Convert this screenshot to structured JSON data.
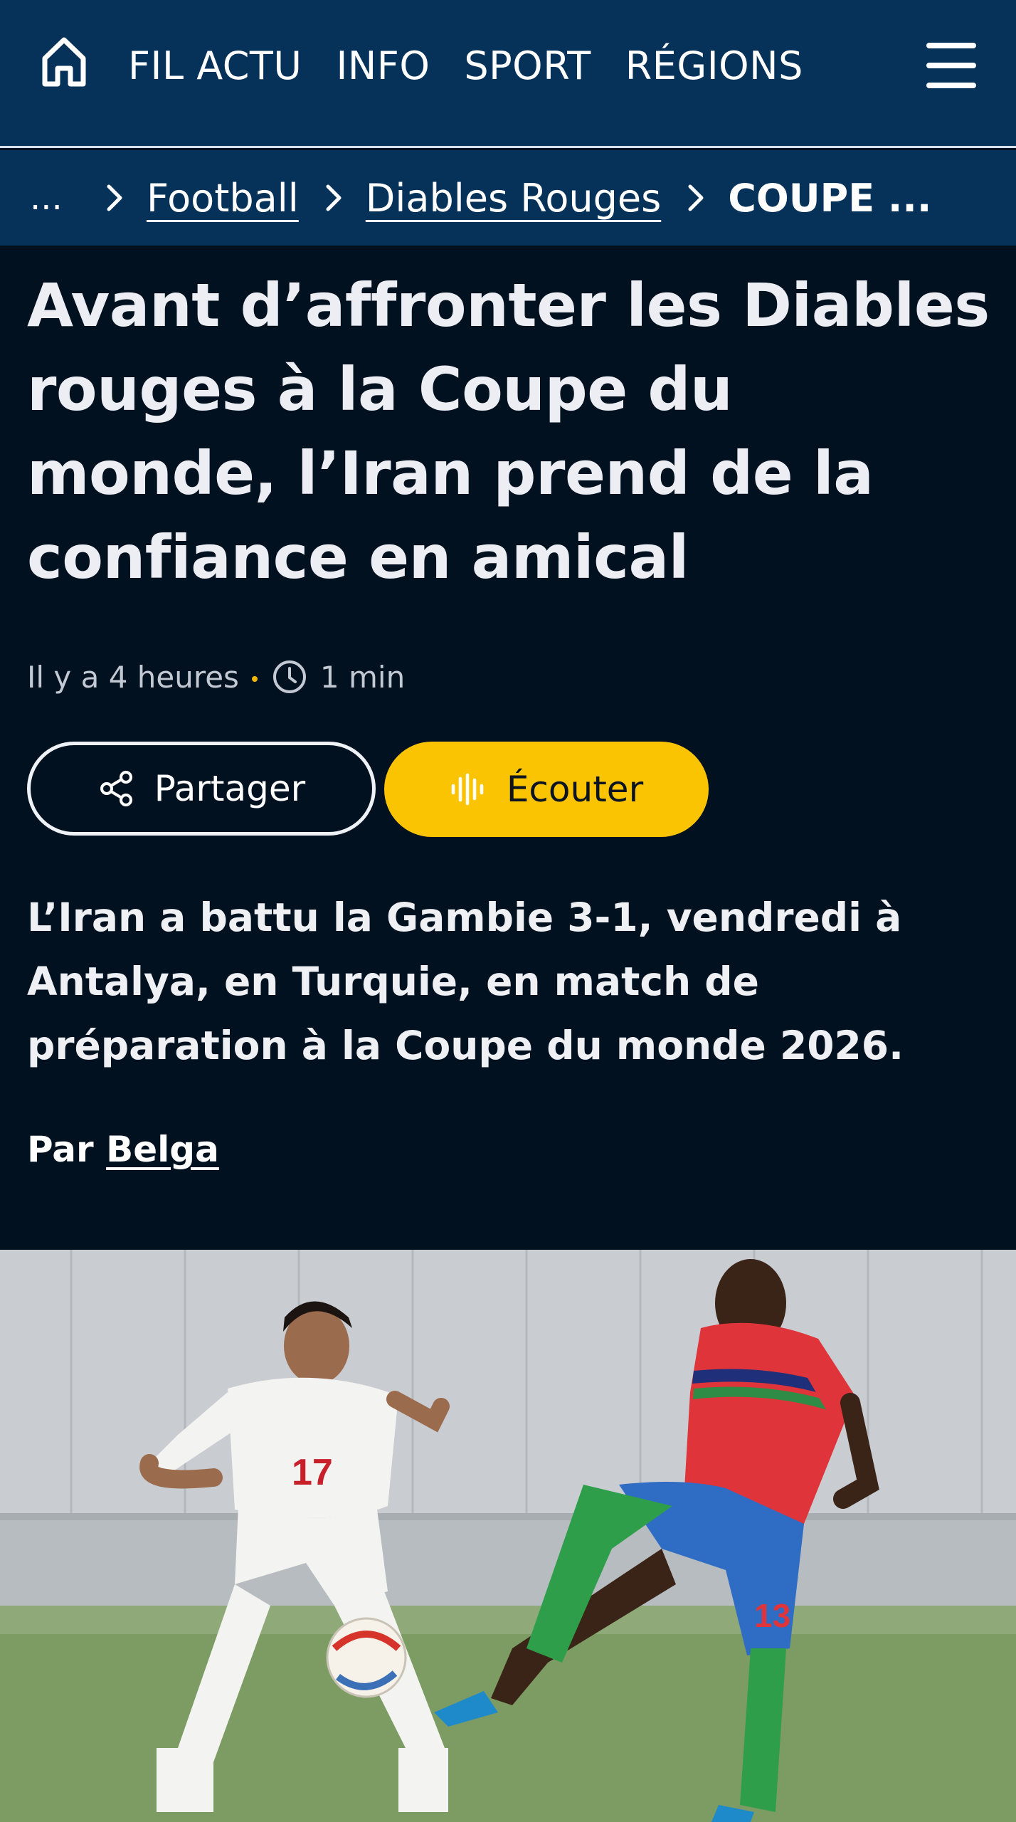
{
  "nav": {
    "items": [
      "FIL ACTU",
      "INFO",
      "SPORT",
      "RÉGIONS"
    ]
  },
  "breadcrumb": {
    "ellipsis": "...",
    "items": [
      "Football",
      "Diables Rouges"
    ],
    "current": "COUPE ..."
  },
  "article": {
    "headline": "Avant d’affronter les Diables rouges à la Coupe du monde, l’Iran prend de la confiance en amical",
    "time_ago": "Il y a 4 heures",
    "read_time": "1 min",
    "share_label": "Partager",
    "listen_label": "Écouter",
    "lede": "L’Iran a battu la Gambie 3-1, vendredi à Antalya, en Turquie, en match de préparation à la Coupe du monde 2026.",
    "byline_prefix": "Par",
    "author": "Belga"
  },
  "photo": {
    "jersey_left": "17",
    "jersey_right": "13"
  },
  "colors": {
    "nav_bg": "#063158",
    "page_bg": "#01111f",
    "accent": "#fbc403"
  }
}
